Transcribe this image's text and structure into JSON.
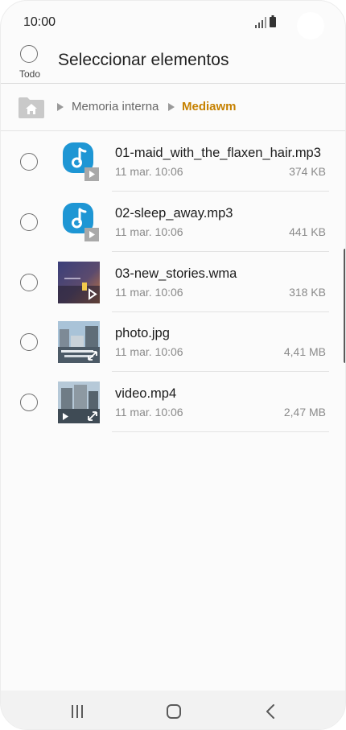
{
  "status_bar": {
    "time": "10:00"
  },
  "header": {
    "select_all_label": "Todo",
    "title": "Seleccionar elementos"
  },
  "breadcrumb": {
    "parent": "Memoria interna",
    "current": "Mediawm"
  },
  "files": [
    {
      "name": "01-maid_with_the_flaxen_hair.mp3",
      "date": "11 mar. 10:06",
      "size": "374 KB",
      "icon": "music-file-icon"
    },
    {
      "name": "02-sleep_away.mp3",
      "date": "11 mar. 10:06",
      "size": "441 KB",
      "icon": "music-file-icon"
    },
    {
      "name": "03-new_stories.wma",
      "date": "11 mar. 10:06",
      "size": "318 KB",
      "icon": "album-thumbnail"
    },
    {
      "name": "photo.jpg",
      "date": "11 mar. 10:06",
      "size": "4,41 MB",
      "icon": "photo-thumbnail"
    },
    {
      "name": "video.mp4",
      "date": "11 mar. 10:06",
      "size": "2,47 MB",
      "icon": "video-thumbnail"
    }
  ],
  "navigation": [
    "recents-icon",
    "home-icon",
    "back-icon"
  ],
  "colors": {
    "breadcrumb_current": "#c68100",
    "music_icon": "#1e96d4"
  }
}
